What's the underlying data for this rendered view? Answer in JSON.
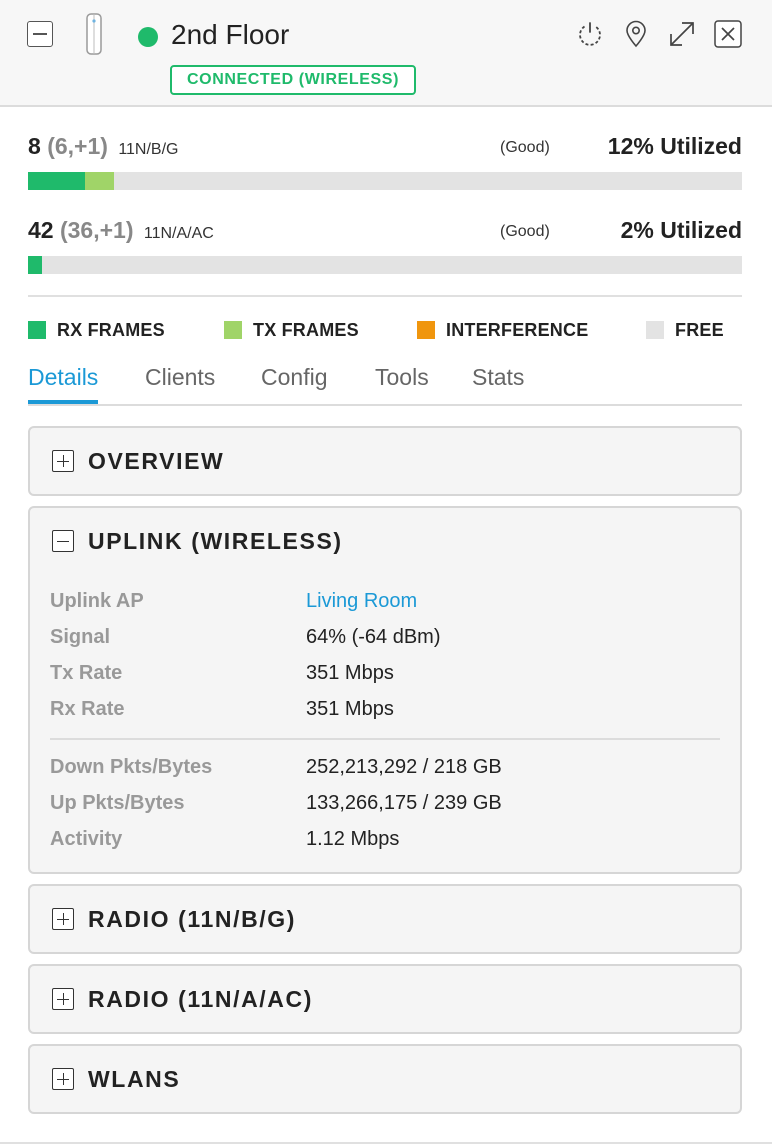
{
  "header": {
    "device_name": "2nd Floor",
    "connection_status": "CONNECTED (WIRELESS)",
    "status_color": "#1fba6b",
    "icons": [
      "collapse-icon",
      "access-point-icon",
      "restart-icon",
      "locate-icon",
      "expand-icon",
      "close-icon"
    ]
  },
  "radios": [
    {
      "count": "8",
      "breakdown": "(6,+1)",
      "band": "11N/B/G",
      "quality": "(Good)",
      "utilization": "12% Utilized",
      "usage": {
        "rx_frames_pct": 8,
        "tx_frames_pct": 4,
        "interference_pct": 0
      }
    },
    {
      "count": "42",
      "breakdown": "(36,+1)",
      "band": "11N/A/AC",
      "quality": "(Good)",
      "utilization": "2% Utilized",
      "usage": {
        "rx_frames_pct": 2,
        "tx_frames_pct": 0,
        "interference_pct": 0
      }
    }
  ],
  "legend": [
    {
      "label": "RX FRAMES",
      "color": "#1fba6b"
    },
    {
      "label": "TX FRAMES",
      "color": "#a0d468"
    },
    {
      "label": "INTERFERENCE",
      "color": "#f0960e"
    },
    {
      "label": "FREE",
      "color": "#e3e3e3"
    }
  ],
  "tabs": [
    {
      "label": "Details",
      "active": true
    },
    {
      "label": "Clients",
      "active": false
    },
    {
      "label": "Config",
      "active": false
    },
    {
      "label": "Tools",
      "active": false
    },
    {
      "label": "Stats",
      "active": false
    }
  ],
  "accent_color": "#1b99d6",
  "sections": {
    "overview": {
      "title": "OVERVIEW",
      "expanded": false
    },
    "uplink": {
      "title": "UPLINK (WIRELESS)",
      "expanded": true,
      "rows": [
        {
          "label": "Uplink AP",
          "value": "Living Room"
        },
        {
          "label": "Signal",
          "value": "64% (-64 dBm)"
        },
        {
          "label": "Tx Rate",
          "value": "351 Mbps"
        },
        {
          "label": "Rx Rate",
          "value": "351 Mbps"
        }
      ],
      "rows2": [
        {
          "label": "Down Pkts/Bytes",
          "value": "252,213,292 / 218 GB"
        },
        {
          "label": "Up Pkts/Bytes",
          "value": "133,266,175 / 239 GB"
        },
        {
          "label": "Activity",
          "value": "1.12 Mbps"
        }
      ]
    },
    "radio_ng": {
      "title": "RADIO (11N/B/G)",
      "expanded": false
    },
    "radio_na": {
      "title": "RADIO (11N/A/AC)",
      "expanded": false
    },
    "wlans": {
      "title": "WLANS",
      "expanded": false
    }
  }
}
